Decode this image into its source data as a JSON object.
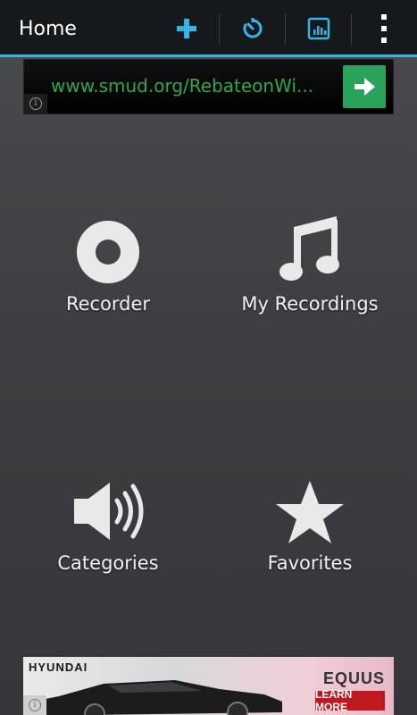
{
  "action_bar": {
    "title": "Home",
    "actions": [
      {
        "icon": "add-icon"
      },
      {
        "icon": "timer-icon"
      },
      {
        "icon": "equalizer-icon"
      },
      {
        "icon": "overflow-menu-icon"
      }
    ],
    "accent_color": "#33b5e5",
    "background_color": "#15191c"
  },
  "top_ad": {
    "url_text": "www.smud.org/RebateonWi...",
    "go_icon": "arrow-right-icon",
    "info_icon": "info-icon",
    "url_color": "#2ea84a",
    "button_color": "#29a35a"
  },
  "tiles": [
    {
      "label": "Recorder",
      "icon": "record-icon"
    },
    {
      "label": "My Recordings",
      "icon": "music-note-icon"
    },
    {
      "label": "Categories",
      "icon": "speaker-icon"
    },
    {
      "label": "Favorites",
      "icon": "star-icon"
    }
  ],
  "bottom_ad": {
    "brand_left": "HYUNDAI",
    "brand_right": "EQUUS",
    "cta": "LEARN MORE",
    "cta_color": "#c0181f",
    "info_icon": "info-icon"
  }
}
